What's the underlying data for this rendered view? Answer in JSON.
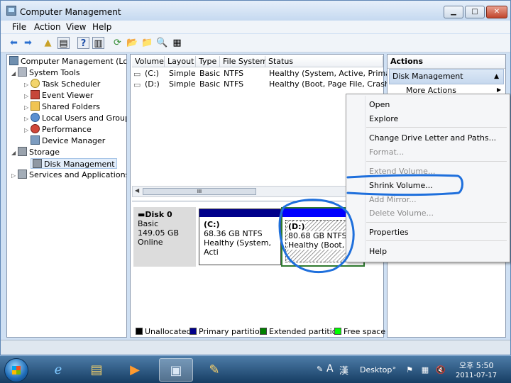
{
  "window": {
    "title": "Computer Management"
  },
  "menu": [
    "File",
    "Action",
    "View",
    "Help"
  ],
  "tree": [
    "Computer Management (Local",
    "System Tools",
    "Task Scheduler",
    "Event Viewer",
    "Shared Folders",
    "Local Users and Groups",
    "Performance",
    "Device Manager",
    "Storage",
    "Disk Management",
    "Services and Applications"
  ],
  "columns": [
    "Volume",
    "Layout",
    "Type",
    "File System",
    "Status"
  ],
  "volumes": [
    {
      "volume": "(C:)",
      "layout": "Simple",
      "type": "Basic",
      "fs": "NTFS",
      "status": "Healthy (System, Active, Primary I"
    },
    {
      "volume": "(D:)",
      "layout": "Simple",
      "type": "Basic",
      "fs": "NTFS",
      "status": "Healthy (Boot, Page File, Crash Du"
    }
  ],
  "scrollbar_grip": "III",
  "disk": {
    "name": "Disk 0",
    "kind": "Basic",
    "size": "149.05 GB",
    "state": "Online"
  },
  "partitions": [
    {
      "label": "(C:)",
      "size": "68.36 GB NTFS",
      "status": "Healthy (System, Acti"
    },
    {
      "label": "(D:)",
      "size": "80.68 GB NTFS",
      "status": "Healthy (Boot, Pa"
    }
  ],
  "legend": [
    "Unallocated",
    "Primary partition",
    "Extended partition",
    "Free space"
  ],
  "legend_colors": [
    "#000000",
    "#00008b",
    "#008000",
    "#00ff00"
  ],
  "actions": {
    "title": "Actions",
    "section": "Disk Management",
    "more": "More Actions"
  },
  "context_menu": {
    "open": "Open",
    "explore": "Explore",
    "change_letter": "Change Drive Letter and Paths...",
    "format": "Format...",
    "extend": "Extend Volume...",
    "shrink": "Shrink Volume...",
    "mirror": "Add Mirror...",
    "delete": "Delete Volume...",
    "properties": "Properties",
    "help": "Help"
  },
  "taskbar": {
    "ime_a": "A",
    "ime_han": "漢",
    "desktop": "Desktop",
    "time": "오후 5:50",
    "date": "2011-07-17"
  },
  "colors": {
    "annotation": "#1e6fdc",
    "primary_bar": "#00008b",
    "logical_bar": "#0000ff",
    "extended_border": "#2f7a2f"
  }
}
